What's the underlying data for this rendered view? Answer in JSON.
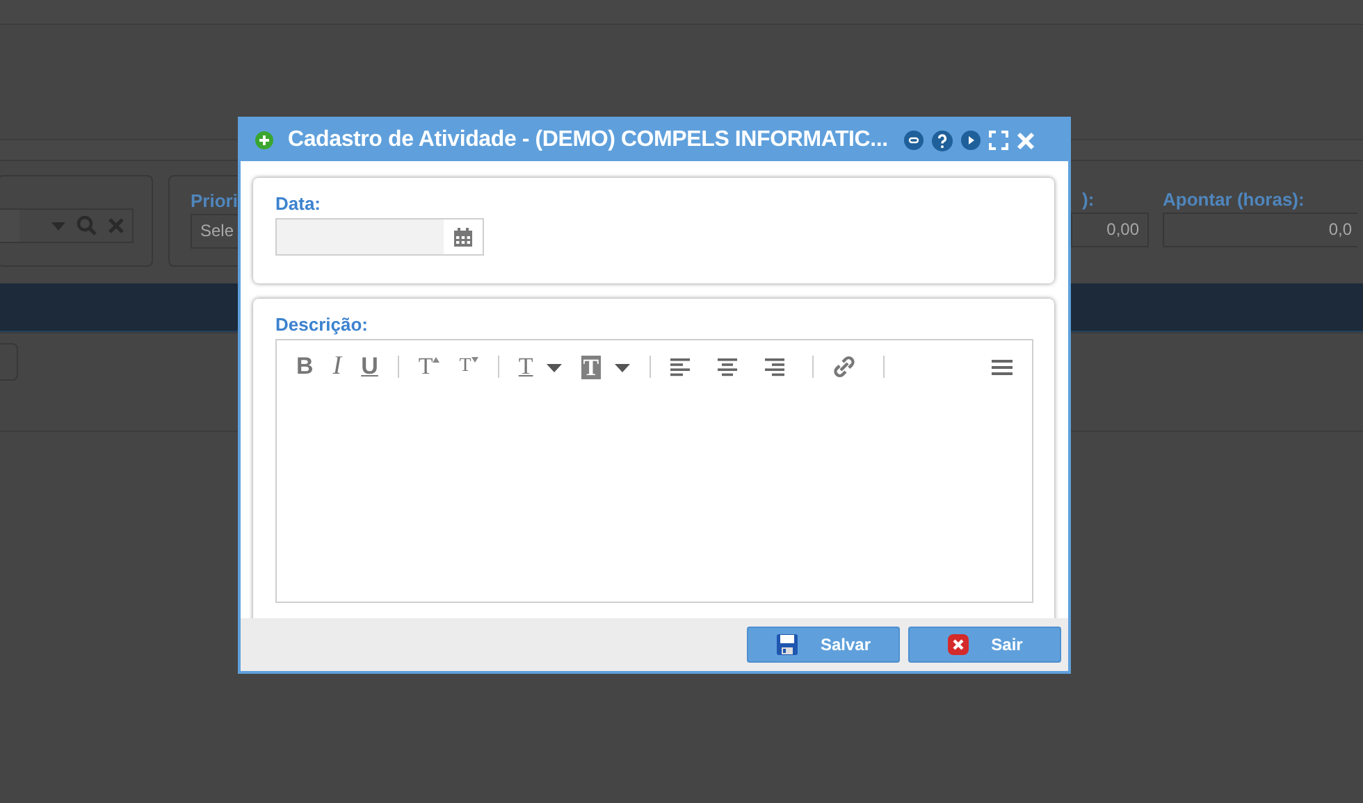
{
  "background_form": {
    "priority_label": "Priori",
    "priority_placeholder": "Sele",
    "hours_label_end": "):",
    "hours_value": "0,00",
    "apontar_label": "Apontar (horas):",
    "apontar_value": "0,0"
  },
  "dialog": {
    "title": "Cadastro de Atividade - (DEMO) COMPELS INFORMATIC...",
    "date_label": "Data:",
    "description_label": "Descrição:",
    "toolbar": [
      {
        "kind": "bold",
        "glyph": "B"
      },
      {
        "kind": "italic",
        "glyph": "I"
      },
      {
        "kind": "underline",
        "glyph": "U"
      },
      {
        "kind": "separator"
      },
      {
        "kind": "grow",
        "glyph": "T"
      },
      {
        "kind": "shrink",
        "glyph": "T"
      },
      {
        "kind": "separator"
      },
      {
        "kind": "color",
        "glyph": "T"
      },
      {
        "kind": "highlight",
        "glyph": "T"
      },
      {
        "kind": "separator"
      },
      {
        "kind": "align-left"
      },
      {
        "kind": "align-center"
      },
      {
        "kind": "align-right"
      },
      {
        "kind": "separator"
      },
      {
        "kind": "link"
      },
      {
        "kind": "separator"
      },
      {
        "kind": "menu"
      }
    ],
    "buttons": [
      {
        "kind": "save",
        "label": "Salvar"
      },
      {
        "kind": "exit",
        "label": "Sair"
      }
    ]
  }
}
